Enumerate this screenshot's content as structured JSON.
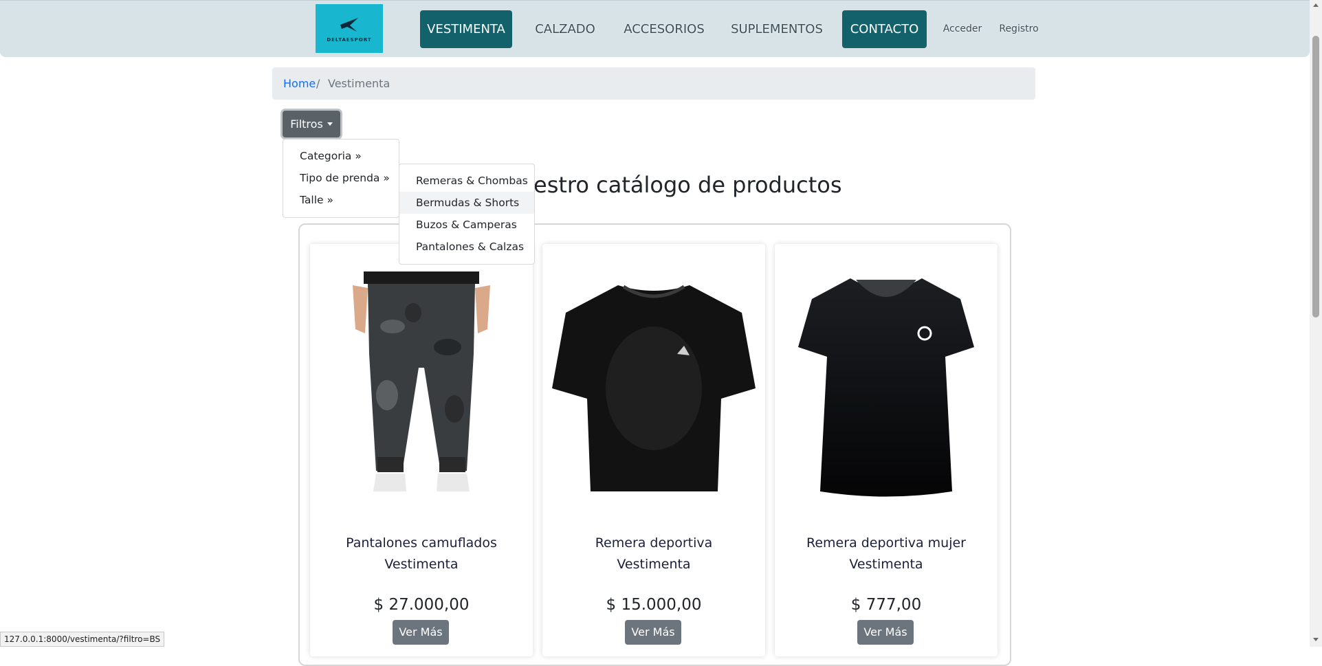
{
  "brand": {
    "logo_text": "DELTAESPORT"
  },
  "nav": {
    "items": [
      "VESTIMENTA",
      "CALZADO",
      "ACCESORIOS",
      "SUPLEMENTOS",
      "CONTACTO"
    ],
    "login": "Acceder",
    "register": "Registro",
    "colors": {
      "bar": "#d8e3e7",
      "active": "#13616b"
    }
  },
  "breadcrumb": {
    "home": "Home",
    "separator": "/",
    "current": "Vestimenta"
  },
  "filters": {
    "button_label": "Filtros",
    "menu": [
      "Categoria »",
      "Tipo de prenda »",
      "Talle »"
    ],
    "submenu": [
      "Remeras & Chombas",
      "Bermudas & Shorts",
      "Buzos & Camperas",
      "Pantalones & Calzas"
    ]
  },
  "page": {
    "heading": "estro catálogo de productos"
  },
  "products": [
    {
      "name": "Pantalones camuflados",
      "category": "Vestimenta",
      "price": "$ 27.000,00",
      "button": "Ver Más"
    },
    {
      "name": "Remera deportiva",
      "category": "Vestimenta",
      "price": "$ 15.000,00",
      "button": "Ver Más"
    },
    {
      "name": "Remera deportiva mujer",
      "category": "Vestimenta",
      "price": "$ 777,00",
      "button": "Ver Más"
    }
  ],
  "status_bar": {
    "url": "127.0.0.1:8000/vestimenta/?filtro=BS"
  }
}
